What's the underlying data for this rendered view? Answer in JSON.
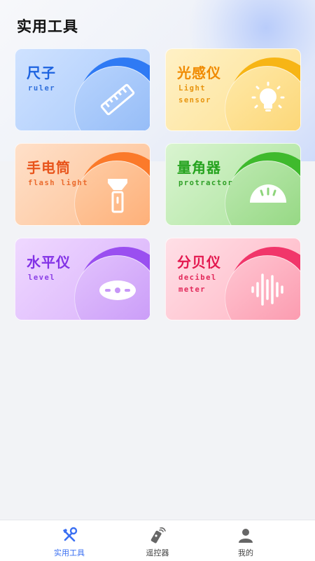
{
  "header": {
    "title": "实用工具"
  },
  "cards": [
    {
      "cn": "尺子",
      "en": "ruler",
      "icon": "ruler-icon",
      "text_color": "#1d63e0",
      "en_color": "#2f6fdc"
    },
    {
      "cn": "光感仪",
      "en": "Light sensor",
      "icon": "lightbulb-icon",
      "text_color": "#f08a00",
      "en_color": "#e7940e"
    },
    {
      "cn": "手电筒",
      "en": "flash light",
      "icon": "flashlight-icon",
      "text_color": "#e8541b",
      "en_color": "#ea6a2c"
    },
    {
      "cn": "量角器",
      "en": "protractor",
      "icon": "protractor-icon",
      "text_color": "#26a31f",
      "en_color": "#2e9f26"
    },
    {
      "cn": "水平仪",
      "en": "level",
      "icon": "level-icon",
      "text_color": "#8231e6",
      "en_color": "#8a3ee6"
    },
    {
      "cn": "分贝仪",
      "en": "decibel meter",
      "icon": "soundwave-icon",
      "text_color": "#e3184f",
      "en_color": "#e2285a"
    }
  ],
  "tabbar": {
    "items": [
      {
        "label": "实用工具",
        "icon": "tools-icon",
        "active": true
      },
      {
        "label": "遥控器",
        "icon": "remote-icon",
        "active": false
      },
      {
        "label": "我的",
        "icon": "user-icon",
        "active": false
      }
    ],
    "active_color": "#3a6ff2"
  }
}
